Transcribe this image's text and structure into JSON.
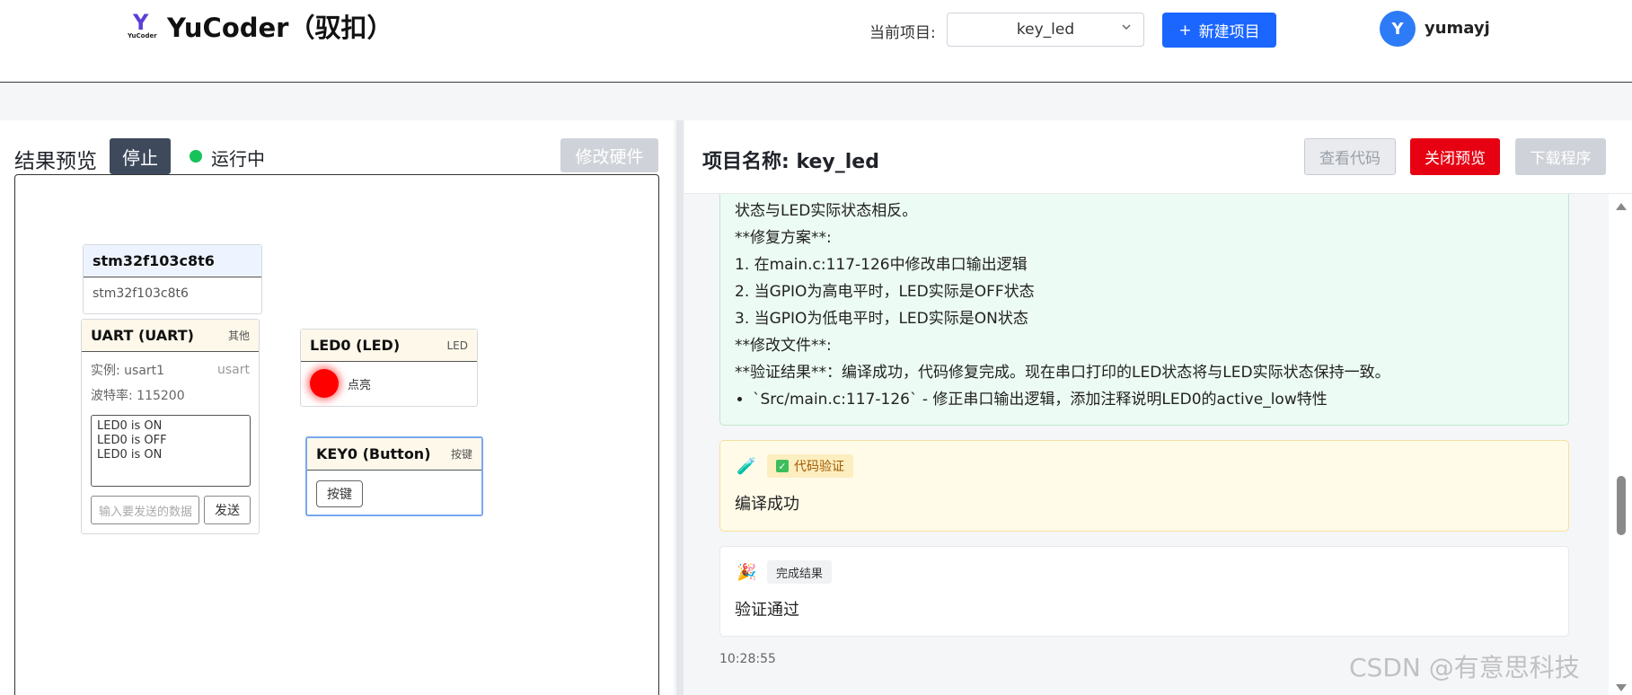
{
  "header": {
    "logo_text": "YuCoder",
    "brand": "YuCoder（驭扣）",
    "project_label": "当前项目:",
    "project_value": "key_led",
    "new_project_label": "新建项目",
    "avatar_letter": "Y",
    "username": "yumayj"
  },
  "preview": {
    "title": "结果预览",
    "stop_label": "停止",
    "status": "运行中",
    "modify_hw_label": "修改硬件",
    "mcu": {
      "title": "stm32f103c8t6",
      "body": "stm32f103c8t6"
    },
    "uart": {
      "title": "UART (UART)",
      "tag": "其他",
      "instance_label": "实例: usart1",
      "instance_type": "usart",
      "baud_label": "波特率: 115200",
      "log": [
        "LED0 is ON",
        "LED0 is OFF",
        "LED0 is ON"
      ],
      "input_placeholder": "输入要发送的数据",
      "send_label": "发送"
    },
    "led": {
      "title": "LED0 (LED)",
      "tag": "LED",
      "state": "点亮",
      "color": "#ff0000"
    },
    "key": {
      "title": "KEY0 (Button)",
      "tag": "按键",
      "button_label": "按键"
    }
  },
  "project": {
    "title": "项目名称: key_led",
    "view_code_label": "查看代码",
    "close_preview_label": "关闭预览",
    "download_label": "下载程序"
  },
  "messages": {
    "fix": {
      "lines": [
        "状态与LED实际状态相反。",
        "**修复方案**:",
        "1. 在main.c:117-126中修改串口输出逻辑",
        "2. 当GPIO为高电平时，LED实际是OFF状态",
        "3. 当GPIO为低电平时，LED实际是ON状态",
        "**修改文件**:",
        "**验证结果**：编译成功，代码修复完成。现在串口打印的LED状态将与LED实际状态保持一致。"
      ],
      "bullet": "`Src/main.c:117-126` - 修正串口输出逻辑，添加注释说明LED0的active_low特性"
    },
    "verify": {
      "icon": "test-tube-icon",
      "badge": "代码验证",
      "body": "编译成功"
    },
    "done": {
      "icon": "party-popper-icon",
      "badge": "完成结果",
      "body": "验证通过"
    },
    "timestamp": "10:28:55"
  },
  "watermark": "CSDN @有意思科技"
}
